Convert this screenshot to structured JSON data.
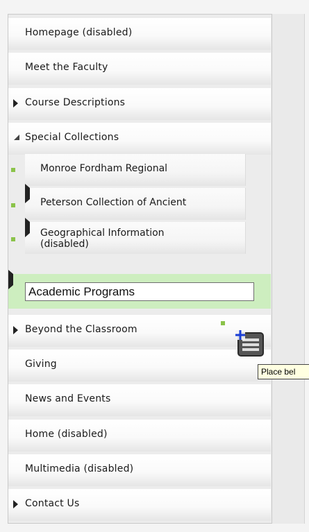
{
  "menu": {
    "items": [
      {
        "label": "Homepage (disabled)"
      },
      {
        "label": "Meet the Faculty"
      },
      {
        "label": "Course Descriptions"
      },
      {
        "label": "Special Collections"
      },
      {
        "label": "Beyond the Classroom"
      },
      {
        "label": "Giving"
      },
      {
        "label": "News and Events"
      },
      {
        "label": "Home (disabled)"
      },
      {
        "label": "Multimedia (disabled)"
      },
      {
        "label": "Contact Us"
      }
    ],
    "sub_items": [
      {
        "label": "Monroe Fordham Regional"
      },
      {
        "label": "Peterson Collection of Ancient"
      },
      {
        "label": "Geographical Information (disabled)"
      }
    ]
  },
  "edit": {
    "value": "Academic Programs"
  },
  "tooltip": {
    "text": "Place bel"
  },
  "colors": {
    "drop_highlight": "#cdeebf",
    "marker": "#8bc34a"
  },
  "icons": {
    "drag_cursor": "stack-add-icon"
  }
}
